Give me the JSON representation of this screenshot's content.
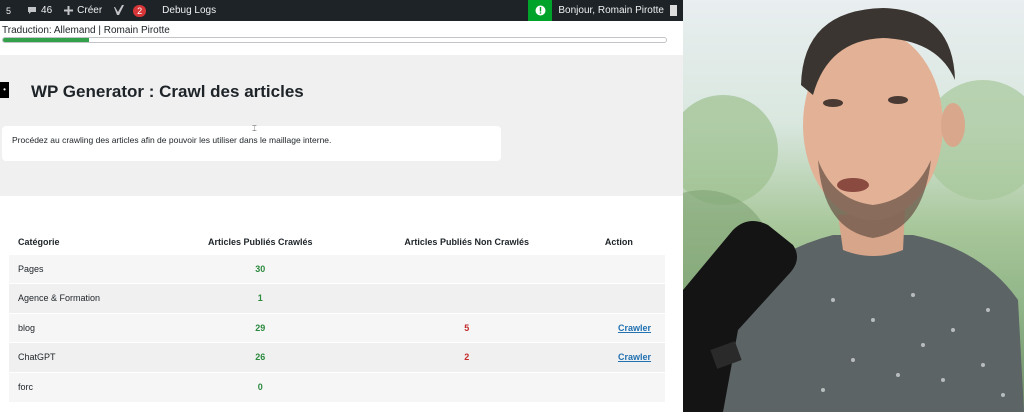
{
  "adminbar": {
    "left_num": "5",
    "comments_count": "46",
    "create_label": "Créer",
    "yoast_badge": "2",
    "debug_label": "Debug Logs",
    "greeting": "Bonjour, Romain Pirotte"
  },
  "translation": {
    "label": "Traduction: Allemand | Romain Pirotte",
    "progress_fraction": 0.13
  },
  "page": {
    "title": "WP Generator : Crawl des articles",
    "description": "Procédez au crawling des articles afin de pouvoir les utiliser dans le maillage interne."
  },
  "table": {
    "headers": [
      "Catégorie",
      "Articles Publiés Crawlés",
      "Articles Publiés Non Crawlés",
      "Action"
    ],
    "rows": [
      {
        "category": "Pages",
        "crawled": "30",
        "not_crawled": "",
        "action": ""
      },
      {
        "category": "Agence & Formation",
        "crawled": "1",
        "not_crawled": "",
        "action": ""
      },
      {
        "category": "blog",
        "crawled": "29",
        "not_crawled": "5",
        "action": "Crawler"
      },
      {
        "category": "ChatGPT",
        "crawled": "26",
        "not_crawled": "2",
        "action": "Crawler"
      },
      {
        "category": "forc",
        "crawled": "0",
        "not_crawled": "",
        "action": ""
      }
    ]
  },
  "colors": {
    "adminbar_bg": "#1d2327",
    "alert_green": "#00a32a",
    "badge_red": "#d63638",
    "crawled_green": "#2b8a3e",
    "not_crawled_red": "#c42b2b",
    "link_blue": "#2271b1"
  },
  "icons": [
    "comment-icon",
    "plus-icon",
    "yoast-icon",
    "alert-icon",
    "avatar"
  ]
}
